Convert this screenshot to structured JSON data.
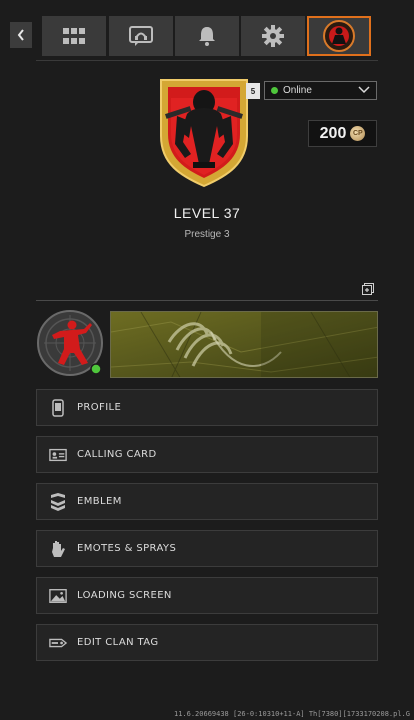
{
  "nav": {
    "tabs": [
      {
        "icon": "grid-icon"
      },
      {
        "icon": "headset-chat-icon"
      },
      {
        "icon": "bell-icon"
      },
      {
        "icon": "gear-icon"
      },
      {
        "icon": "operator-emblem-icon",
        "active": true
      }
    ]
  },
  "profile": {
    "level_badge": "5",
    "status": "Online",
    "currency": "200",
    "currency_icon": "CP",
    "level": "LEVEL 37",
    "prestige": "Prestige 3"
  },
  "menu": [
    {
      "label": "PROFILE",
      "icon": "phone-icon"
    },
    {
      "label": "CALLING CARD",
      "icon": "id-card-icon"
    },
    {
      "label": "EMBLEM",
      "icon": "chevron-rank-icon"
    },
    {
      "label": "EMOTES & SPRAYS",
      "icon": "hand-icon"
    },
    {
      "label": "LOADING SCREEN",
      "icon": "image-icon"
    },
    {
      "label": "EDIT CLAN TAG",
      "icon": "tag-icon"
    }
  ],
  "version": "11.6.20669438 [26-0:10310+11-A] Th[7380][1733170208.pl.G",
  "colors": {
    "accent": "#e0701c",
    "online": "#4fc73c",
    "emblem_red": "#d21b1b",
    "emblem_gold": "#d4a734"
  }
}
